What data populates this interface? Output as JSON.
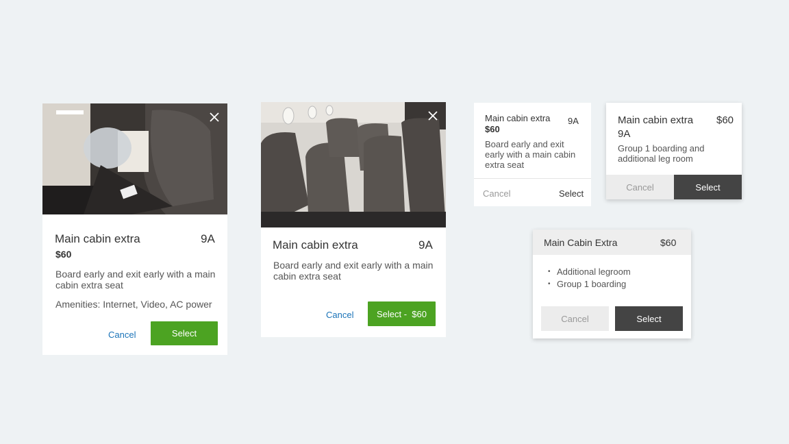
{
  "card1": {
    "title": "Main cabin extra",
    "seat": "9A",
    "price": "$60",
    "description": "Board early and exit early with a main cabin extra seat",
    "amenities": "Amenities: Internet, Video, AC power",
    "cancel_label": "Cancel",
    "select_label": "Select",
    "close_icon": "close-icon"
  },
  "card2": {
    "title": "Main cabin extra",
    "seat": "9A",
    "description": "Board early and exit early with a main cabin extra seat",
    "cancel_label": "Cancel",
    "select_label": "Select -  $60",
    "close_icon": "close-icon"
  },
  "card3": {
    "title": "Main cabin extra",
    "price": "$60",
    "seat": "9A",
    "description": "Board early and exit early with a main cabin extra seat",
    "cancel_label": "Cancel",
    "select_label": "Select"
  },
  "card4": {
    "title": "Main cabin extra",
    "price": "$60",
    "seat": "9A",
    "description": "Group 1 boarding and additional leg room",
    "cancel_label": "Cancel",
    "select_label": "Select"
  },
  "card5": {
    "title": "Main Cabin Extra",
    "price": "$60",
    "bullets": [
      "Additional legroom",
      "Group 1 boarding"
    ],
    "cancel_label": "Cancel",
    "select_label": "Select"
  },
  "colors": {
    "background": "#eef2f4",
    "green": "#4ca322",
    "link_blue": "#1a73b8",
    "dark_button": "#444444",
    "gray_button": "#ececec"
  }
}
